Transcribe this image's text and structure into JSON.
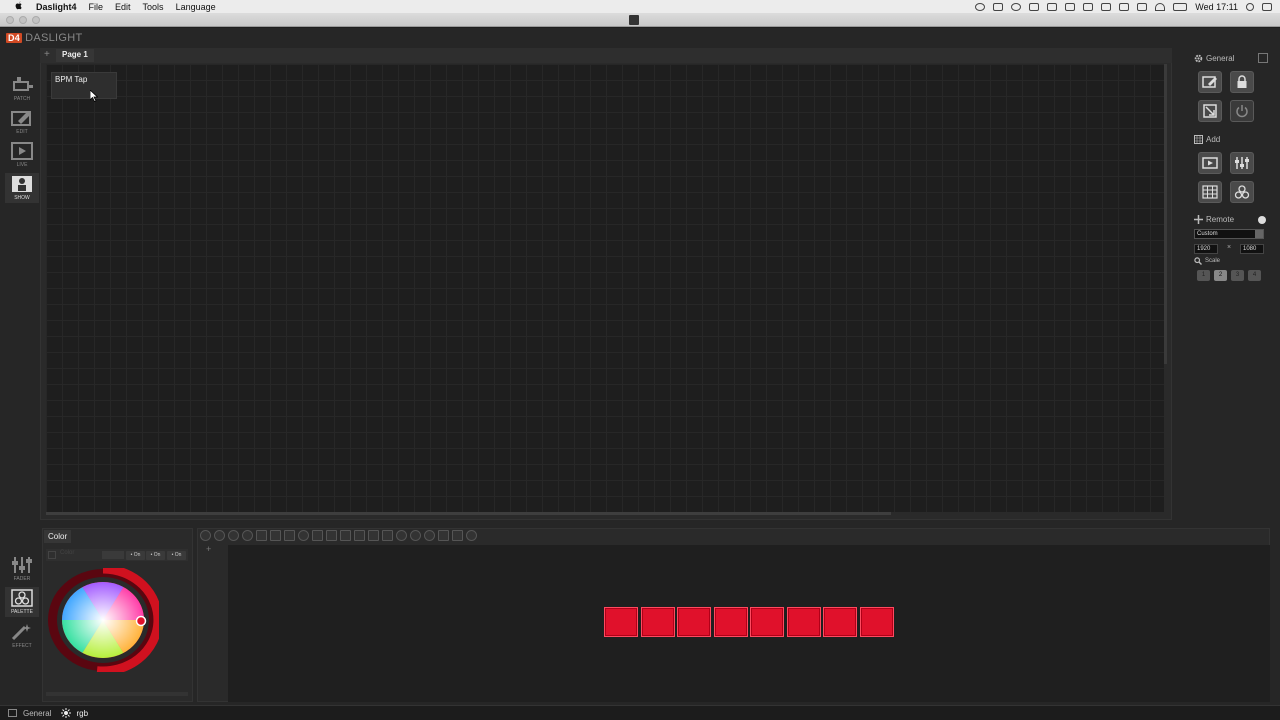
{
  "menubar": {
    "apple": "",
    "app_name": "Daslight4",
    "items": [
      "File",
      "Edit",
      "Tools",
      "Language"
    ],
    "clock": "Wed 17:11"
  },
  "app": {
    "logo_mark": "D4",
    "logo_text": "DASLIGHT"
  },
  "left_nav": [
    {
      "label": "PATCH",
      "icon": "patch-icon"
    },
    {
      "label": "EDIT",
      "icon": "edit-icon"
    },
    {
      "label": "LIVE",
      "icon": "live-icon"
    },
    {
      "label": "SHOW",
      "icon": "show-icon",
      "active": true
    }
  ],
  "page_tabs": {
    "add": "+",
    "tabs": [
      {
        "label": "Page 1"
      }
    ]
  },
  "widgets": [
    {
      "label": "BPM Tap"
    }
  ],
  "right_panel": {
    "general_label": "General",
    "add_label": "Add",
    "remote_label": "Remote",
    "remote_select": "Custom",
    "res_width": "1920",
    "res_sep": "×",
    "res_height": "1080",
    "scale_label": "Scale",
    "scale_options": [
      "1",
      "2",
      "3",
      "4"
    ],
    "scale_selected": "2"
  },
  "bottom_nav": [
    {
      "label": "FADER",
      "icon": "fader-icon"
    },
    {
      "label": "PALETTE",
      "icon": "palette-icon",
      "active": true
    },
    {
      "label": "EFFECT",
      "icon": "effect-icon"
    }
  ],
  "color_panel": {
    "tab_label": "Color",
    "toolbar_label": "Color",
    "on_buttons": [
      "• On",
      "• On",
      "• On"
    ],
    "accent": "#e0112b"
  },
  "fixture_view": {
    "add": "+",
    "fixture_count": 8,
    "fixture_color": "#e0112b"
  },
  "statusbar": {
    "items": [
      {
        "label": "General",
        "icon": "general-icon"
      },
      {
        "label": "rgb",
        "icon": "sun-icon"
      }
    ]
  }
}
